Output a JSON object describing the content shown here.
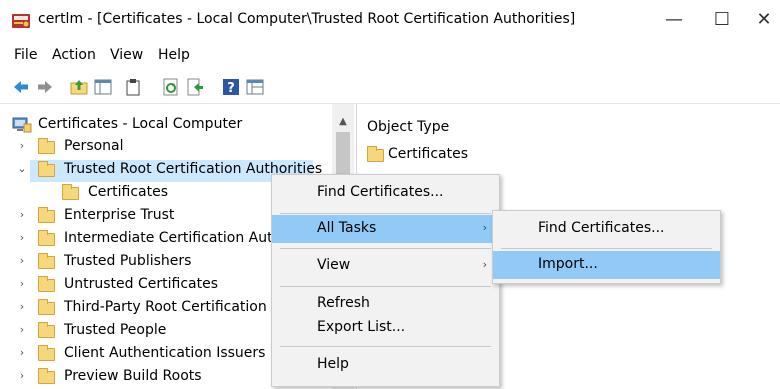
{
  "window": {
    "title": "certlm - [Certificates - Local Computer\\Trusted Root Certification Authorities]",
    "minimize": "—",
    "maximize": "☐",
    "close": "✕"
  },
  "menubar": [
    "File",
    "Action",
    "View",
    "Help"
  ],
  "toolbar": [
    "back-arrow-icon",
    "forward-arrow-icon",
    "up-folder-icon",
    "show-hide-tree-icon",
    "clipboard-icon",
    "refresh-icon",
    "export-icon",
    "help-icon",
    "properties-icon"
  ],
  "tree": {
    "root": "Certificates - Local Computer",
    "items": [
      {
        "label": "Personal",
        "expanded": false
      },
      {
        "label": "Trusted Root Certification Authorities",
        "expanded": true,
        "selected": true
      },
      {
        "label": "Certificates",
        "child": true
      },
      {
        "label": "Enterprise Trust",
        "expanded": false
      },
      {
        "label": "Intermediate Certification Autho",
        "expanded": false
      },
      {
        "label": "Trusted Publishers",
        "expanded": false
      },
      {
        "label": "Untrusted Certificates",
        "expanded": false
      },
      {
        "label": "Third-Party Root Certification A",
        "expanded": false
      },
      {
        "label": "Trusted People",
        "expanded": false
      },
      {
        "label": "Client Authentication Issuers",
        "expanded": false
      },
      {
        "label": "Preview Build Roots",
        "expanded": false
      }
    ]
  },
  "right_pane": {
    "header": "Object Type",
    "items": [
      "Certificates"
    ]
  },
  "context_menu": {
    "items": [
      "Find Certificates...",
      "All Tasks",
      "View",
      "Refresh",
      "Export List...",
      "Help"
    ],
    "highlighted": "All Tasks"
  },
  "submenu": {
    "items": [
      "Find Certificates...",
      "Import..."
    ],
    "highlighted": "Import..."
  },
  "colors": {
    "selection": "#cce8ff",
    "menu_highlight": "#91c9f7",
    "folder": "#f6d77c"
  }
}
